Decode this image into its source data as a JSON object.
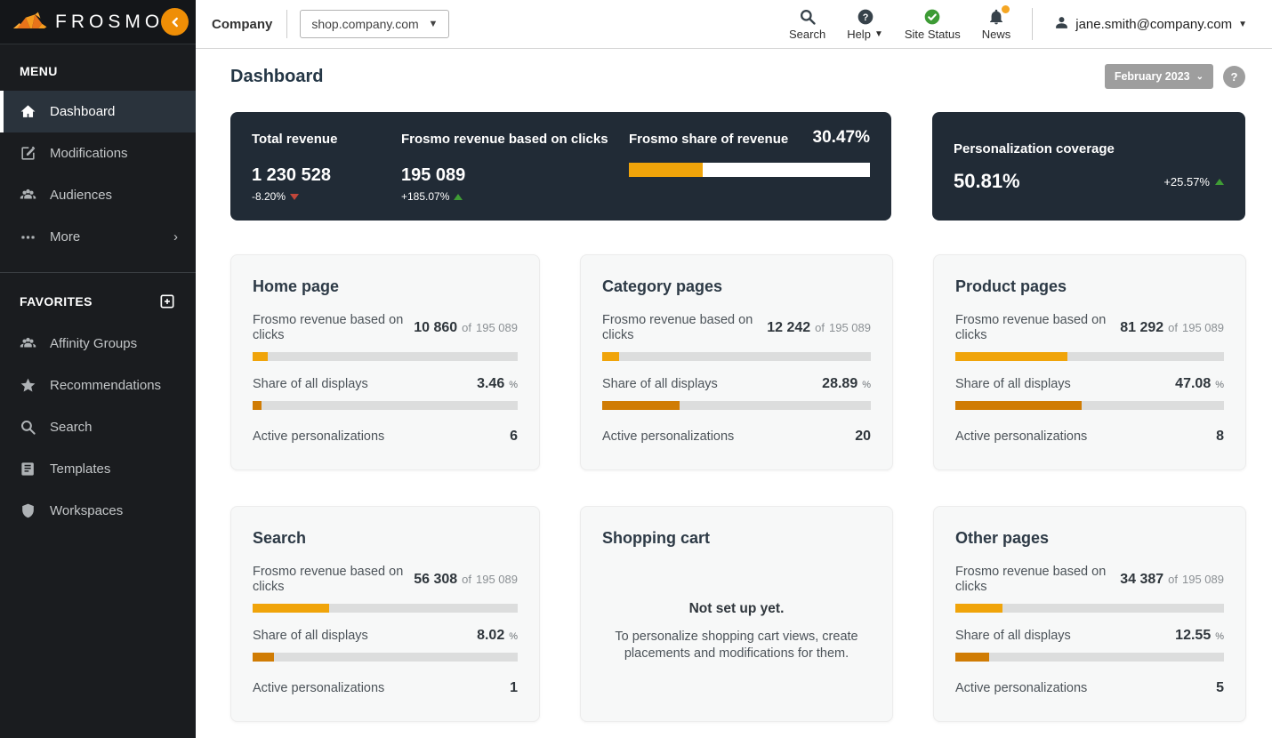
{
  "brand": {
    "name": "FROSMO"
  },
  "topbar": {
    "company_label": "Company",
    "site_dropdown": {
      "value": "shop.company.com"
    },
    "search_label": "Search",
    "help_label": "Help",
    "site_status_label": "Site Status",
    "news_label": "News",
    "user_email": "jane.smith@company.com"
  },
  "sidebar": {
    "menu_header": "MENU",
    "menu_items": [
      {
        "label": "Dashboard",
        "icon": "home-icon",
        "active": true
      },
      {
        "label": "Modifications",
        "icon": "edit-icon",
        "active": false
      },
      {
        "label": "Audiences",
        "icon": "users-icon",
        "active": false
      },
      {
        "label": "More",
        "icon": "ellipsis-icon",
        "active": false,
        "has_submenu": true
      }
    ],
    "favorites_header": "FAVORITES",
    "favorites_items": [
      {
        "label": "Affinity Groups",
        "icon": "users-icon"
      },
      {
        "label": "Recommendations",
        "icon": "star-icon"
      },
      {
        "label": "Search",
        "icon": "search-icon"
      },
      {
        "label": "Templates",
        "icon": "book-icon"
      },
      {
        "label": "Workspaces",
        "icon": "shield-icon"
      }
    ]
  },
  "page": {
    "title": "Dashboard",
    "period_button": "February 2023",
    "help_button": "?"
  },
  "kpis": {
    "total_revenue": {
      "label": "Total revenue",
      "value": "1 230 528",
      "change": "-8.20%",
      "direction": "down"
    },
    "frosmo_revenue": {
      "label": "Frosmo revenue based on clicks",
      "value": "195 089",
      "change": "+185.07%",
      "direction": "up"
    },
    "share_of_revenue": {
      "label": "Frosmo share of revenue",
      "value": "30.47%",
      "percent": 30.47
    },
    "personalization_coverage": {
      "label": "Personalization coverage",
      "value": "50.81%",
      "change": "+25.57%",
      "direction": "up"
    }
  },
  "card_labels": {
    "revenue": "Frosmo revenue based on clicks",
    "of": "of",
    "total": "195 089",
    "share": "Share of all displays",
    "percent_suffix": "%",
    "active": "Active personalizations"
  },
  "cards": [
    {
      "title": "Home page",
      "revenue_value": "10 860",
      "revenue_pct": 5.57,
      "share_value": "3.46",
      "share_pct": 3.46,
      "active_value": "6"
    },
    {
      "title": "Category pages",
      "revenue_value": "12 242",
      "revenue_pct": 6.27,
      "share_value": "28.89",
      "share_pct": 28.89,
      "active_value": "20"
    },
    {
      "title": "Product pages",
      "revenue_value": "81 292",
      "revenue_pct": 41.67,
      "share_value": "47.08",
      "share_pct": 47.08,
      "active_value": "8"
    },
    {
      "title": "Search",
      "revenue_value": "56 308",
      "revenue_pct": 28.86,
      "share_value": "8.02",
      "share_pct": 8.02,
      "active_value": "1"
    },
    {
      "title": "Shopping cart",
      "empty_title": "Not set up yet.",
      "empty_text": "To personalize shopping cart views, create placements and modifications for them."
    },
    {
      "title": "Other pages",
      "revenue_value": "34 387",
      "revenue_pct": 17.63,
      "share_value": "12.55",
      "share_pct": 12.55,
      "active_value": "5"
    }
  ],
  "colors": {
    "accent_orange": "#f0a40a",
    "bar_dark_orange": "#d07c04",
    "positive_green": "#3f9c35",
    "negative_red": "#c2463a",
    "dark_card_bg": "#212b36"
  }
}
